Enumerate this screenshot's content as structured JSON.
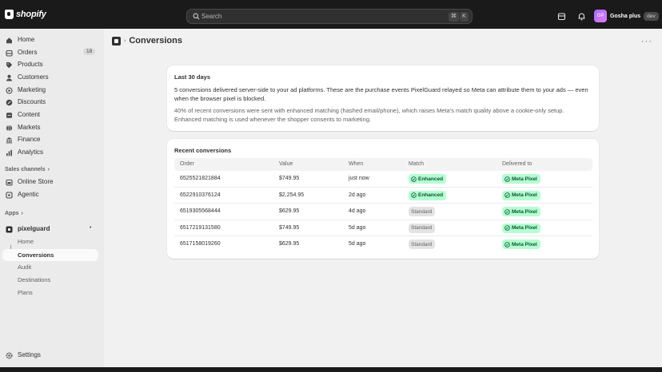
{
  "brand": {
    "wordmark": "shopify"
  },
  "topbar": {
    "search_placeholder": "Search",
    "shortcut_keys": [
      "⌘",
      "K"
    ],
    "user": {
      "initials": "GP",
      "name": "Gosha plus",
      "badge": "dev"
    }
  },
  "sidebar": {
    "items": [
      {
        "label": "Home",
        "icon": "home-icon"
      },
      {
        "label": "Orders",
        "icon": "orders-icon",
        "count": "18"
      },
      {
        "label": "Products",
        "icon": "tag-icon"
      },
      {
        "label": "Customers",
        "icon": "person-icon"
      },
      {
        "label": "Marketing",
        "icon": "target-icon"
      },
      {
        "label": "Discounts",
        "icon": "discount-icon"
      },
      {
        "label": "Content",
        "icon": "content-icon"
      },
      {
        "label": "Markets",
        "icon": "globe-icon"
      },
      {
        "label": "Finance",
        "icon": "bank-icon"
      },
      {
        "label": "Analytics",
        "icon": "chart-icon"
      }
    ],
    "sales_channels_label": "Sales channels",
    "sales_channels": [
      {
        "label": "Online Store",
        "icon": "store-icon"
      },
      {
        "label": "Agentic",
        "icon": "agentic-icon"
      }
    ],
    "apps_label": "Apps",
    "app": {
      "name": "pixelguard",
      "subitems": [
        "Home",
        "Conversions",
        "Audit",
        "Destinations",
        "Plans"
      ],
      "active": "Conversions"
    },
    "settings_label": "Settings"
  },
  "page": {
    "title": "Conversions",
    "summary": {
      "heading": "Last 30 days",
      "paragraph1": "5 conversions delivered server-side to your ad platforms. These are the purchase events PixelGuard relayed so Meta can attribute them to your ads — even when the browser pixel is blocked.",
      "paragraph2": "40% of recent conversions were sent with enhanced matching (hashed email/phone), which raises Meta's match quality above a cookie-only setup. Enhanced matching is used whenever the shopper consents to marketing."
    },
    "recent": {
      "heading": "Recent conversions",
      "columns": [
        "Order",
        "Value",
        "When",
        "Match",
        "Delivered to"
      ],
      "rows": [
        {
          "order": "6525521821884",
          "value": "$749.95",
          "when": "just now",
          "match": "Enhanced",
          "delivered": "Meta Pixel"
        },
        {
          "order": "6522910376124",
          "value": "$2,254.95",
          "when": "2d ago",
          "match": "Enhanced",
          "delivered": "Meta Pixel"
        },
        {
          "order": "6519305568444",
          "value": "$629.95",
          "when": "4d ago",
          "match": "Standard",
          "delivered": "Meta Pixel"
        },
        {
          "order": "6517219131580",
          "value": "$749.95",
          "when": "5d ago",
          "match": "Standard",
          "delivered": "Meta Pixel"
        },
        {
          "order": "6517158019260",
          "value": "$629.95",
          "when": "5d ago",
          "match": "Standard",
          "delivered": "Meta Pixel"
        }
      ]
    }
  },
  "colors": {
    "success_bg": "#b4fed2",
    "success_text": "#0c5132",
    "neutral_bg": "#e3e3e3",
    "topbar": "#1a1a1a",
    "sidebar": "#ebebeb",
    "canvas": "#f1f1f1"
  }
}
